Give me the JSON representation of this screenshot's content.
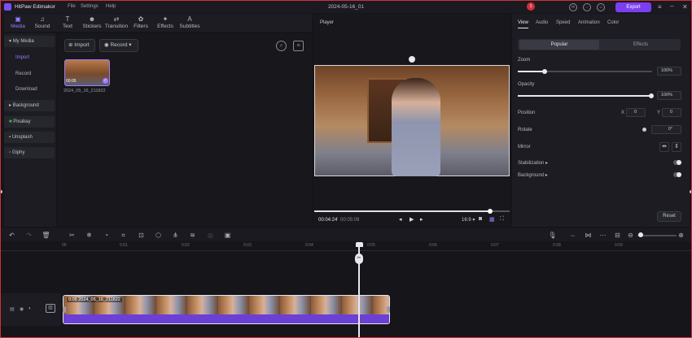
{
  "app": {
    "name": "HitPaw Edimakor",
    "menu": [
      "File",
      "Settings",
      "Help"
    ],
    "doc_title": "2024-05-16_01",
    "notif_count": "1",
    "export_label": "Export"
  },
  "toolbar": [
    {
      "label": "Media",
      "icon": "media-icon",
      "active": true
    },
    {
      "label": "Sound",
      "icon": "music-icon"
    },
    {
      "label": "Text",
      "icon": "text-icon"
    },
    {
      "label": "Stickers",
      "icon": "sticker-icon"
    },
    {
      "label": "Transition",
      "icon": "transition-icon"
    },
    {
      "label": "Filters",
      "icon": "filter-icon"
    },
    {
      "label": "Effects",
      "icon": "effects-icon"
    },
    {
      "label": "Subtitles",
      "icon": "subtitle-icon"
    }
  ],
  "sidebar": {
    "my_media": "My Media",
    "import": "Import",
    "record": "Record",
    "download": "Download",
    "background": "Background",
    "pixabay": "Pixabay",
    "unsplash": "Unsplash",
    "giphy": "Giphy"
  },
  "media": {
    "import_btn": "Import",
    "record_btn": "Record",
    "thumb_duration": "00:05",
    "thumb_name": "2024_05_16_211822"
  },
  "player": {
    "title": "Player",
    "current_time": "00:04:24",
    "total_time": "00:05:09",
    "aspect": "16:9",
    "progress": 0.9
  },
  "props": {
    "tabs": [
      "View",
      "Audio",
      "Speed",
      "Animation",
      "Color"
    ],
    "seg": [
      "Popular",
      "Effects"
    ],
    "zoom_label": "Zoom",
    "zoom_value": "100%",
    "opacity_label": "Opacity",
    "opacity_value": "100%",
    "position_label": "Position",
    "pos_x_label": "X",
    "pos_x": "0",
    "pos_y_label": "Y",
    "pos_y": "0",
    "rotate_label": "Rotate",
    "rotate_value": "0°",
    "mirror_label": "Mirror",
    "stabilization_label": "Stabilization",
    "background_label": "Background",
    "reset_label": "Reset"
  },
  "timeline": {
    "ticks": [
      "00",
      "0:01",
      "0:02",
      "0:03",
      "0:04",
      "0:05",
      "0:06",
      "0:07",
      "0:08",
      "0:09"
    ],
    "clip_label": "0:05  2024_05_16_211822"
  }
}
